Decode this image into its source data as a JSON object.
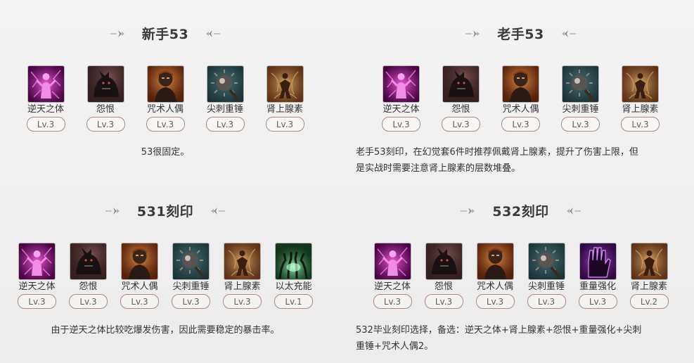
{
  "panels": [
    {
      "title": "新手53",
      "skills": [
        {
          "name": "逆天之体",
          "level": "Lv.3",
          "icon": "purple-body-icon"
        },
        {
          "name": "怨恨",
          "level": "Lv.3",
          "icon": "beast-icon"
        },
        {
          "name": "咒术人偶",
          "level": "Lv.3",
          "icon": "puppet-icon"
        },
        {
          "name": "尖刺重锤",
          "level": "Lv.3",
          "icon": "spike-ball-icon"
        },
        {
          "name": "肾上腺素",
          "level": "Lv.3",
          "icon": "adrenaline-icon"
        }
      ],
      "description": "53很固定。"
    },
    {
      "title": "老手53",
      "skills": [
        {
          "name": "逆天之体",
          "level": "Lv.3",
          "icon": "purple-body-icon"
        },
        {
          "name": "怨恨",
          "level": "Lv.3",
          "icon": "beast-icon"
        },
        {
          "name": "咒术人偶",
          "level": "Lv.3",
          "icon": "puppet-icon"
        },
        {
          "name": "尖刺重锤",
          "level": "Lv.3",
          "icon": "spike-ball-icon"
        },
        {
          "name": "肾上腺素",
          "level": "Lv.3",
          "icon": "adrenaline-icon"
        }
      ],
      "description_lines": [
        "老手53刻印，在幻觉套6件时推荐佩戴肾上腺素，提升了伤害上限，但",
        "是实战时需要注意肾上腺素的层数堆叠。"
      ]
    },
    {
      "title": "531刻印",
      "skills": [
        {
          "name": "逆天之体",
          "level": "Lv.3",
          "icon": "purple-body-icon"
        },
        {
          "name": "怨恨",
          "level": "Lv.3",
          "icon": "beast-icon"
        },
        {
          "name": "咒术人偶",
          "level": "Lv.3",
          "icon": "puppet-icon"
        },
        {
          "name": "尖刺重锤",
          "level": "Lv.3",
          "icon": "spike-ball-icon"
        },
        {
          "name": "肾上腺素",
          "level": "Lv.3",
          "icon": "adrenaline-icon"
        },
        {
          "name": "以太充能",
          "level": "Lv.1",
          "icon": "ether-hands-icon"
        }
      ],
      "description": "由于逆天之体比较吃爆发伤害，因此需要稳定的暴击率。"
    },
    {
      "title": "532刻印",
      "skills": [
        {
          "name": "逆天之体",
          "level": "Lv.3",
          "icon": "purple-body-icon"
        },
        {
          "name": "怨恨",
          "level": "Lv.3",
          "icon": "beast-icon"
        },
        {
          "name": "咒术人偶",
          "level": "Lv.3",
          "icon": "puppet-icon"
        },
        {
          "name": "尖刺重锤",
          "level": "Lv.3",
          "icon": "spike-ball-icon"
        },
        {
          "name": "重量强化",
          "level": "Lv.3",
          "icon": "purple-glove-icon"
        },
        {
          "name": "肾上腺素",
          "level": "Lv.2",
          "icon": "adrenaline-icon"
        }
      ],
      "description_lines": [
        "532毕业刻印选择，备选：逆天之体+肾上腺素+怨恨+重量强化+尖刺",
        "重锤+咒术人偶2。"
      ]
    }
  ]
}
